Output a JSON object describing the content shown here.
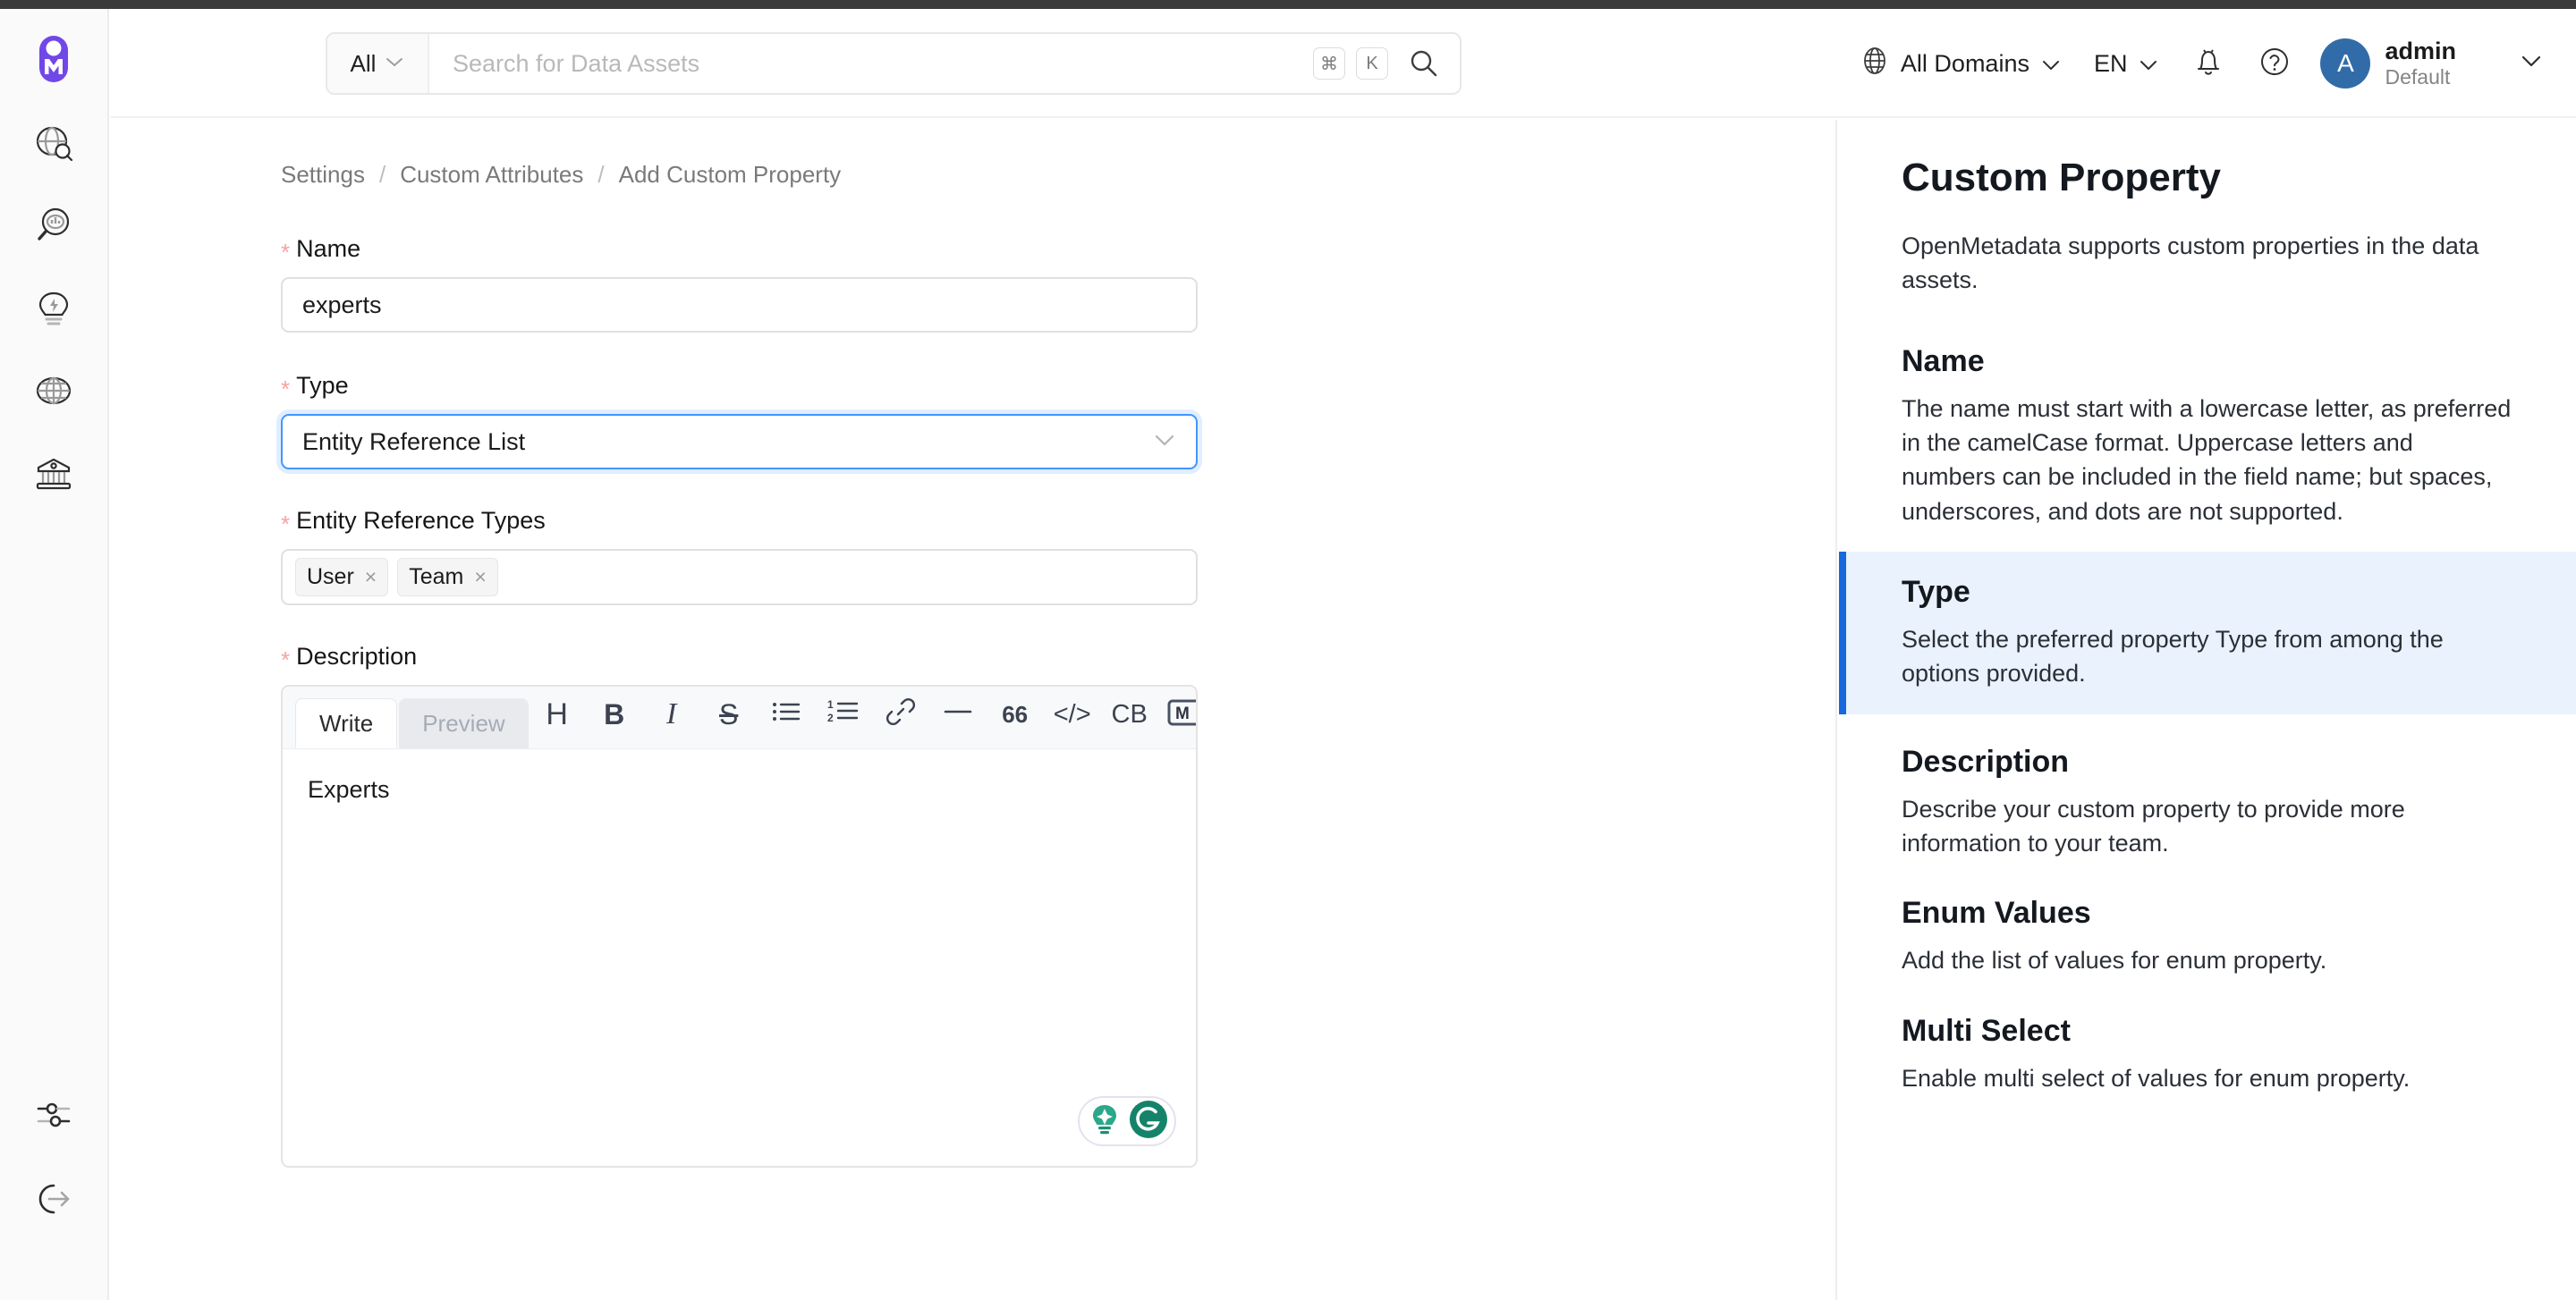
{
  "header": {
    "search": {
      "scope_label": "All",
      "placeholder": "Search for Data Assets",
      "value": "",
      "kbd_cmd": "⌘",
      "kbd_key": "K"
    },
    "domains_label": "All Domains",
    "language_label": "EN",
    "user": {
      "initial": "A",
      "name": "admin",
      "subtitle": "Default"
    }
  },
  "sidebar": {
    "items": [
      {
        "name": "explore",
        "icon": "globe-search-icon"
      },
      {
        "name": "observability",
        "icon": "magnifier-chart-icon"
      },
      {
        "name": "insights",
        "icon": "lightbulb-icon"
      },
      {
        "name": "domains",
        "icon": "globe-icon"
      },
      {
        "name": "govern",
        "icon": "bank-icon"
      }
    ],
    "bottom_items": [
      {
        "name": "settings",
        "icon": "sliders-icon"
      },
      {
        "name": "logout",
        "icon": "logout-icon"
      }
    ]
  },
  "breadcrumb": [
    {
      "label": "Settings"
    },
    {
      "label": "Custom Attributes"
    },
    {
      "label": "Add Custom Property"
    }
  ],
  "breadcrumb_separator": "/",
  "form": {
    "name": {
      "label": "Name",
      "required_marker": "*",
      "value": "experts",
      "placeholder": ""
    },
    "type": {
      "label": "Type",
      "required_marker": "*",
      "value": "Entity Reference List"
    },
    "entity_reference_types": {
      "label": "Entity Reference Types",
      "required_marker": "*",
      "tags": [
        {
          "label": "User",
          "remove": "×"
        },
        {
          "label": "Team",
          "remove": "×"
        }
      ]
    },
    "description": {
      "label": "Description",
      "required_marker": "*",
      "tabs": [
        {
          "label": "Write",
          "active": true
        },
        {
          "label": "Preview",
          "active": false
        }
      ],
      "toolbar": [
        {
          "name": "heading",
          "glyph": "H"
        },
        {
          "name": "bold",
          "glyph": "B"
        },
        {
          "name": "italic",
          "glyph": "I"
        },
        {
          "name": "strikethrough",
          "glyph": "S"
        },
        {
          "name": "bullet-list",
          "glyph": ""
        },
        {
          "name": "numbered-list",
          "glyph": ""
        },
        {
          "name": "link",
          "glyph": ""
        },
        {
          "name": "horizontal-rule",
          "glyph": ""
        },
        {
          "name": "blockquote",
          "glyph": "66"
        },
        {
          "name": "code",
          "glyph": "</>"
        },
        {
          "name": "code-block",
          "glyph": "CB"
        },
        {
          "name": "markdown-guide",
          "glyph": "M"
        }
      ],
      "content": "Experts"
    }
  },
  "right_panel": {
    "title": "Custom Property",
    "intro": "OpenMetadata supports custom properties in the data assets.",
    "sections": [
      {
        "heading": "Name",
        "body": "The name must start with a lowercase letter, as preferred in the camelCase format. Uppercase letters and numbers can be included in the field name; but spaces, underscores, and dots are not supported.",
        "active": false
      },
      {
        "heading": "Type",
        "body": "Select the preferred property Type from among the options provided.",
        "active": true
      },
      {
        "heading": "Description",
        "body": "Describe your custom property to provide more information to your team.",
        "active": false
      },
      {
        "heading": "Enum Values",
        "body": "Add the list of values for enum property.",
        "active": false
      },
      {
        "heading": "Multi Select",
        "body": "Enable multi select of values for enum property.",
        "active": false
      }
    ]
  },
  "colors": {
    "brand_purple": "#7147E8",
    "accent_blue": "#1668dc",
    "focus_blue": "#4096ff",
    "active_section_bg": "#e9f2fd",
    "avatar_blue": "#326ca8",
    "required_red": "#f5a3a3",
    "grammarly_green": "#15836a"
  }
}
